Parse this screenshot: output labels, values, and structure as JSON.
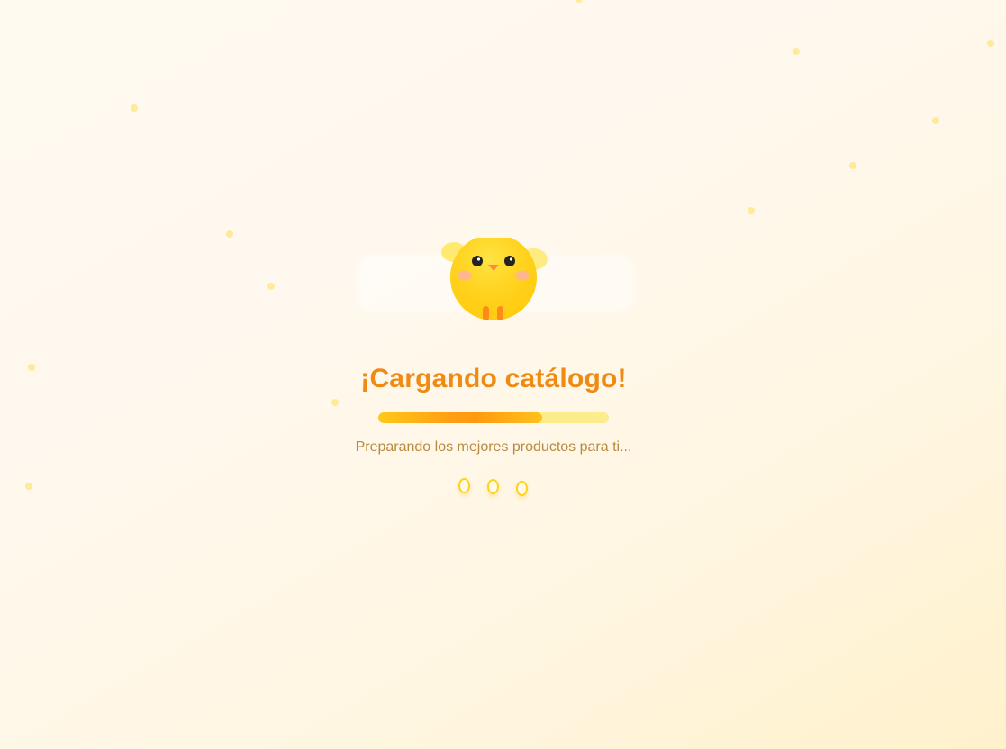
{
  "loader": {
    "title": "¡Cargando catálogo!",
    "subtitle": "Preparando los mejores productos para ti...",
    "progress": 0.71
  },
  "mascot": {
    "icon": "chick-icon"
  },
  "colors": {
    "accent": "#ef8a12",
    "chick_body": "#ffd21e",
    "progress_track": "#fdec8c",
    "subtitle_text": "#b98a3e",
    "sparkle": "#ffe88a"
  }
}
